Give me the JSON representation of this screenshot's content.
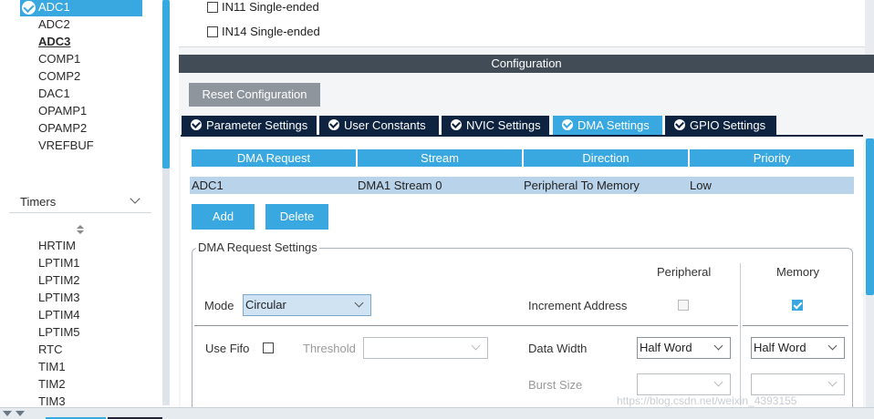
{
  "left_panel": {
    "peripherals": [
      {
        "label": "ADC1",
        "selected": true,
        "bold": false
      },
      {
        "label": "ADC2",
        "selected": false,
        "bold": false
      },
      {
        "label": "ADC3",
        "selected": false,
        "bold": true
      },
      {
        "label": "COMP1",
        "selected": false,
        "bold": false
      },
      {
        "label": "COMP2",
        "selected": false,
        "bold": false
      },
      {
        "label": "DAC1",
        "selected": false,
        "bold": false
      },
      {
        "label": "OPAMP1",
        "selected": false,
        "bold": false
      },
      {
        "label": "OPAMP2",
        "selected": false,
        "bold": false
      },
      {
        "label": "VREFBUF",
        "selected": false,
        "bold": false
      }
    ],
    "timers_header": "Timers",
    "timers": [
      "HRTIM",
      "LPTIM1",
      "LPTIM2",
      "LPTIM3",
      "LPTIM4",
      "LPTIM5",
      "RTC",
      "TIM1",
      "TIM2",
      "TIM3"
    ]
  },
  "channels": [
    {
      "label": "IN11 Single-ended",
      "checked": false
    },
    {
      "label": "IN14 Single-ended",
      "checked": false
    }
  ],
  "configuration": {
    "title": "Configuration",
    "reset_label": "Reset Configuration",
    "tabs": [
      {
        "label": "Parameter Settings",
        "active": false
      },
      {
        "label": "User Constants",
        "active": false
      },
      {
        "label": "NVIC Settings",
        "active": false
      },
      {
        "label": "DMA Settings",
        "active": true
      },
      {
        "label": "GPIO Settings",
        "active": false
      }
    ]
  },
  "dma_table": {
    "headers": [
      "DMA Request",
      "Stream",
      "Direction",
      "Priority"
    ],
    "rows": [
      [
        "ADC1",
        "DMA1 Stream 0",
        "Peripheral To Memory",
        "Low"
      ]
    ]
  },
  "buttons": {
    "add": "Add",
    "delete": "Delete"
  },
  "dma_request_settings": {
    "title": "DMA Request Settings",
    "col_peripheral": "Peripheral",
    "col_memory": "Memory",
    "mode_label": "Mode",
    "mode_value": "Circular",
    "increment_address_label": "Increment Address",
    "increment_peripheral": false,
    "increment_memory": true,
    "use_fifo_label": "Use Fifo",
    "use_fifo": false,
    "threshold_label": "Threshold",
    "threshold_value": "",
    "data_width_label": "Data Width",
    "data_width_peripheral": "Half Word",
    "data_width_memory": "Half Word",
    "burst_size_label": "Burst Size",
    "burst_peripheral": "",
    "burst_memory": ""
  },
  "watermark": "https://blog.csdn.net/weixin_4393155",
  "colors": {
    "accent": "#3aa8e0",
    "dark_tab": "#0d2340",
    "header_bar": "#414c56"
  }
}
